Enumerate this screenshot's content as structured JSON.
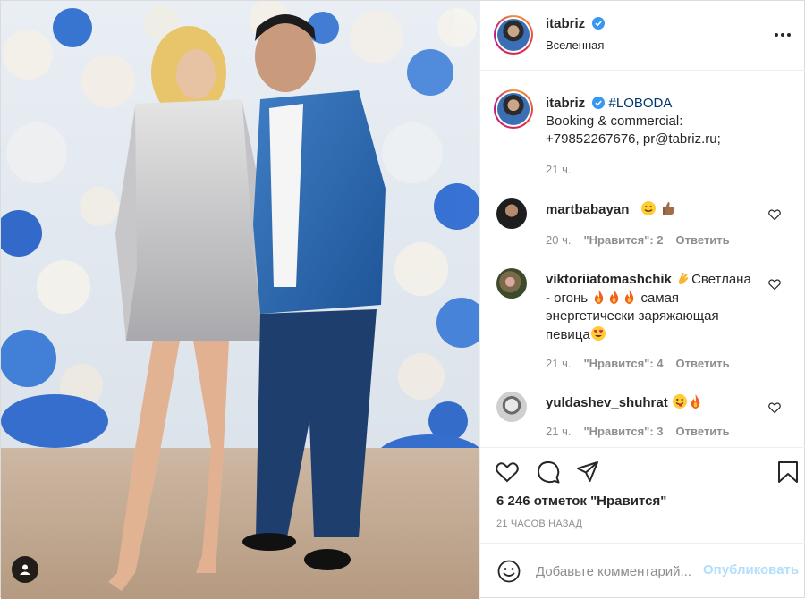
{
  "header": {
    "username": "itabriz",
    "location": "Вселенная"
  },
  "caption": {
    "username": "itabriz",
    "hashtag": "#LOBODA",
    "line1": "Booking & commercial:",
    "line2": "+79852267676, pr@tabriz.ru;",
    "time": "21 ч."
  },
  "comments": [
    {
      "username": "martbabayan_",
      "text": "",
      "emojis": [
        "smile",
        "thumbs-up"
      ],
      "time": "20 ч.",
      "likes": "\"Нравится\": 2",
      "reply": "Ответить"
    },
    {
      "username": "viktoriiatomashchik",
      "text_a": "Светлана",
      "text_b": "- огонь",
      "text_c": "самая",
      "text_d": "энергетически заряжающая",
      "text_e": "певица",
      "time": "21 ч.",
      "likes": "\"Нравится\": 4",
      "reply": "Ответить"
    },
    {
      "username": "yuldashev_shuhrat",
      "text": "",
      "time": "21 ч.",
      "likes": "\"Нравится\": 3",
      "reply": "Ответить"
    }
  ],
  "actions": {
    "likes_count": "6 246 отметок \"Нравится\"",
    "time_ago": "21 ЧАСОВ НАЗАД"
  },
  "add_comment": {
    "placeholder": "Добавьте комментарий...",
    "publish_label": "Опубликовать"
  },
  "colors": {
    "text": "#262626",
    "secondary": "#8e8e8e",
    "link": "#00376b",
    "verified": "#3897f0",
    "publish_disabled": "#b2dffc",
    "border": "#efefef"
  }
}
